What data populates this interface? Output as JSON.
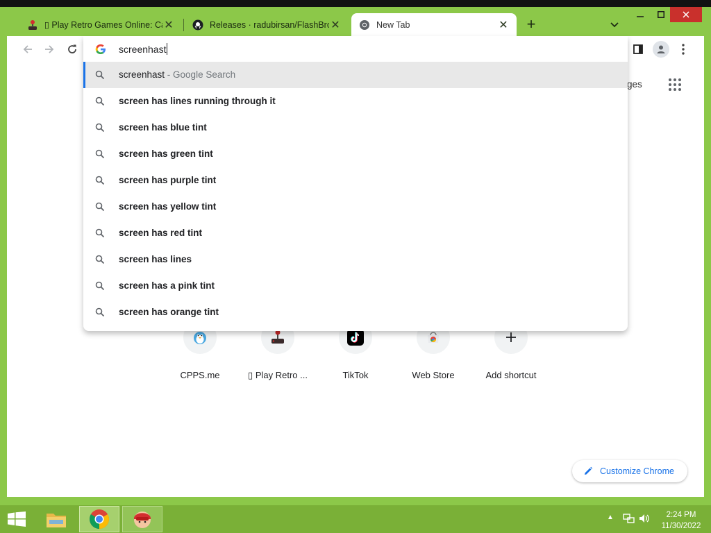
{
  "tabs": [
    {
      "title": "▯ Play Retro Games Online: Cate",
      "icon": "joystick-icon"
    },
    {
      "title": "Releases · radubirsan/FlashBrows",
      "icon": "github-icon"
    },
    {
      "title": "New Tab",
      "icon": "chrome-icon",
      "active": true
    }
  ],
  "omnibox": {
    "query": "screenhast",
    "suggestions": [
      {
        "bold": "",
        "plain": "screenhast",
        "suffix": " - Google Search",
        "selected": true
      },
      {
        "bold": "screen has lines running through it"
      },
      {
        "bold": "screen has blue tint"
      },
      {
        "bold": "screen has green tint"
      },
      {
        "bold": "screen has purple tint"
      },
      {
        "bold": "screen has yellow tint"
      },
      {
        "bold": "screen has red tint"
      },
      {
        "bold": "screen has lines"
      },
      {
        "bold": "screen has a pink tint"
      },
      {
        "bold": "screen has orange tint"
      }
    ]
  },
  "newtab": {
    "images_link": "nages",
    "shortcuts": [
      {
        "label": "CPPS.me",
        "icon": "penguin-icon"
      },
      {
        "label": "▯ Play Retro ...",
        "icon": "joystick-icon"
      },
      {
        "label": "TikTok",
        "icon": "tiktok-icon"
      },
      {
        "label": "Web Store",
        "icon": "webstore-icon"
      },
      {
        "label": "Add shortcut",
        "icon": "plus-icon"
      }
    ],
    "customize_label": "Customize Chrome"
  },
  "taskbar": {
    "time": "2:24 PM",
    "date": "11/30/2022"
  },
  "colors": {
    "frame": "#8cc849",
    "taskbar": "#7ab037",
    "accent": "#1a73e8"
  }
}
